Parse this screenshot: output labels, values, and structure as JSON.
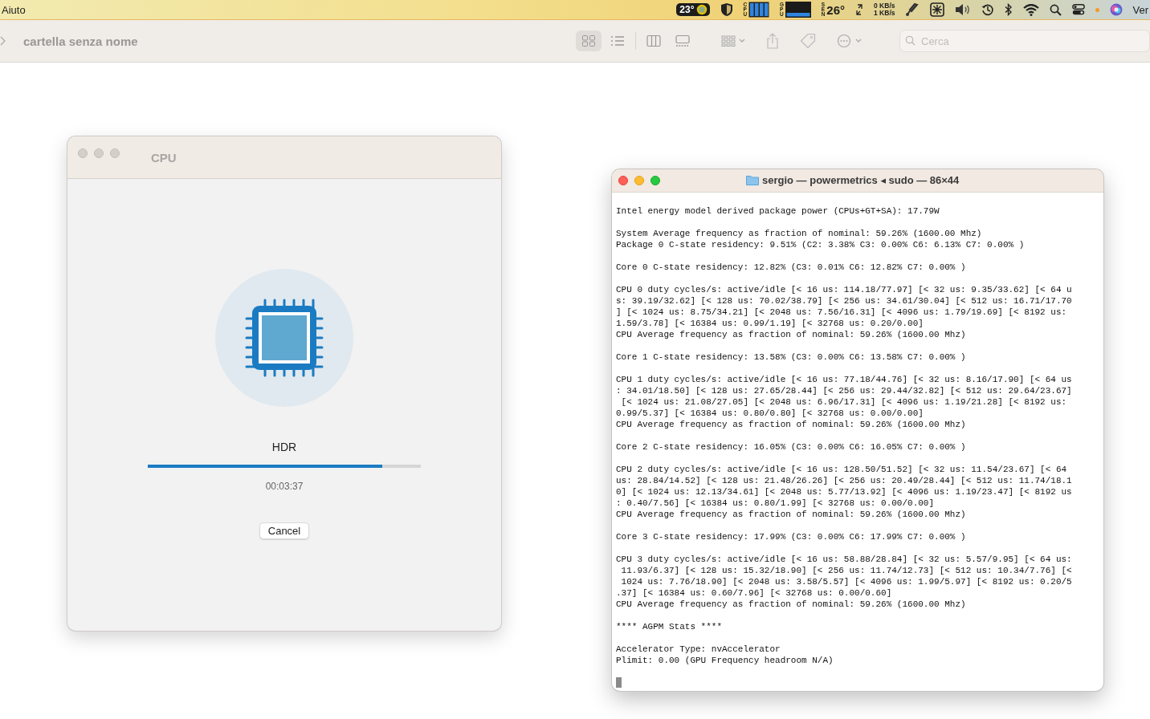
{
  "menu_bar": {
    "app_menu": "Aiuto",
    "temperature_badge": "23°",
    "cpu_label": "CPU",
    "gpu_label": "GPU",
    "sensor_label": "SEN",
    "sensor_temp": "26°",
    "net_down": "0 KB/s",
    "net_up": "1 KB/s",
    "cut_item": "Ver"
  },
  "finder": {
    "title": "cartella senza nome",
    "views": [
      {
        "kind": "icons",
        "selected": true
      },
      {
        "kind": "list",
        "selected": false
      },
      {
        "kind": "columns",
        "selected": false
      },
      {
        "kind": "gallery",
        "selected": false
      }
    ],
    "search": {
      "placeholder": "Cerca"
    }
  },
  "cpu_window": {
    "title": "CPU",
    "task": "HDR",
    "progress": {
      "level": 0.86
    },
    "elapsed": "00:03:37",
    "buttons": [
      "Cancel"
    ]
  },
  "terminal": {
    "title": "sergio — powermetrics ◂ sudo — 86×44",
    "blocks": [
      [
        "Intel energy model derived package power (CPUs+GT+SA): 17.79W"
      ],
      [
        "System Average frequency as fraction of nominal: 59.26% (1600.00 Mhz)",
        "Package 0 C-state residency: 9.51% (C2: 3.38% C3: 0.00% C6: 6.13% C7: 0.00% )"
      ],
      [
        "Core 0 C-state residency: 12.82% (C3: 0.01% C6: 12.82% C7: 0.00% )"
      ],
      [
        "CPU 0 duty cycles/s: active/idle [< 16 us: 114.18/77.97] [< 32 us: 9.35/33.62] [< 64 u",
        "s: 39.19/32.62] [< 128 us: 70.02/38.79] [< 256 us: 34.61/30.04] [< 512 us: 16.71/17.70",
        "] [< 1024 us: 8.75/34.21] [< 2048 us: 7.56/16.31] [< 4096 us: 1.79/19.69] [< 8192 us:",
        "1.59/3.78] [< 16384 us: 0.99/1.19] [< 32768 us: 0.20/0.00]",
        "CPU Average frequency as fraction of nominal: 59.26% (1600.00 Mhz)"
      ],
      [
        "Core 1 C-state residency: 13.58% (C3: 0.00% C6: 13.58% C7: 0.00% )"
      ],
      [
        "CPU 1 duty cycles/s: active/idle [< 16 us: 77.18/44.76] [< 32 us: 8.16/17.90] [< 64 us",
        ": 34.01/18.50] [< 128 us: 27.65/28.44] [< 256 us: 29.44/32.82] [< 512 us: 29.64/23.67]",
        " [< 1024 us: 21.08/27.05] [< 2048 us: 6.96/17.31] [< 4096 us: 1.19/21.28] [< 8192 us:",
        "0.99/5.37] [< 16384 us: 0.80/0.80] [< 32768 us: 0.00/0.00]",
        "CPU Average frequency as fraction of nominal: 59.26% (1600.00 Mhz)"
      ],
      [
        "Core 2 C-state residency: 16.05% (C3: 0.00% C6: 16.05% C7: 0.00% )"
      ],
      [
        "CPU 2 duty cycles/s: active/idle [< 16 us: 128.50/51.52] [< 32 us: 11.54/23.67] [< 64",
        "us: 28.84/14.52] [< 128 us: 21.48/26.26] [< 256 us: 20.49/28.44] [< 512 us: 11.74/18.1",
        "0] [< 1024 us: 12.13/34.61] [< 2048 us: 5.77/13.92] [< 4096 us: 1.19/23.47] [< 8192 us",
        ": 0.40/7.56] [< 16384 us: 0.80/1.99] [< 32768 us: 0.00/0.00]",
        "CPU Average frequency as fraction of nominal: 59.26% (1600.00 Mhz)"
      ],
      [
        "Core 3 C-state residency: 17.99% (C3: 0.00% C6: 17.99% C7: 0.00% )"
      ],
      [
        "CPU 3 duty cycles/s: active/idle [< 16 us: 58.88/28.84] [< 32 us: 5.57/9.95] [< 64 us:",
        " 11.93/6.37] [< 128 us: 15.32/18.90] [< 256 us: 11.74/12.73] [< 512 us: 10.34/7.76] [<",
        " 1024 us: 7.76/18.90] [< 2048 us: 3.58/5.57] [< 4096 us: 1.99/5.97] [< 8192 us: 0.20/5",
        ".37] [< 16384 us: 0.60/7.96] [< 32768 us: 0.00/0.60]",
        "CPU Average frequency as fraction of nominal: 59.26% (1600.00 Mhz)"
      ],
      [
        "**** AGPM Stats ****"
      ],
      [
        "Accelerator Type: nvAccelerator",
        "Plimit: 0.00 (GPU Frequency headroom N/A)"
      ]
    ]
  }
}
